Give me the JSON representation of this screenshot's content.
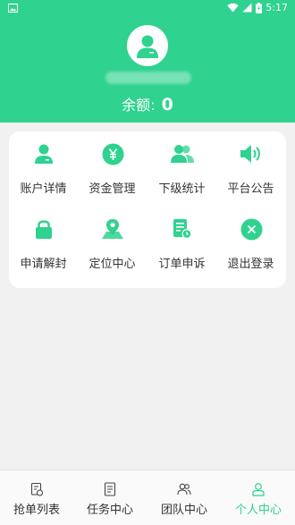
{
  "status_bar": {
    "time": "5:17"
  },
  "profile": {
    "balance_label": "余额:",
    "balance_value": "0"
  },
  "menu": [
    {
      "label": "账户详情",
      "icon": "user-icon"
    },
    {
      "label": "资金管理",
      "icon": "yen-icon"
    },
    {
      "label": "下级统计",
      "icon": "group-icon"
    },
    {
      "label": "平台公告",
      "icon": "speaker-icon"
    },
    {
      "label": "申请解封",
      "icon": "lock-icon"
    },
    {
      "label": "定位中心",
      "icon": "location-pin-icon"
    },
    {
      "label": "订单申诉",
      "icon": "document-clock-icon"
    },
    {
      "label": "退出登录",
      "icon": "close-circle-icon"
    }
  ],
  "tabs": [
    {
      "label": "抢单列表",
      "icon": "receipt-icon",
      "active": false
    },
    {
      "label": "任务中心",
      "icon": "clipboard-icon",
      "active": false
    },
    {
      "label": "团队中心",
      "icon": "team-icon",
      "active": false
    },
    {
      "label": "个人中心",
      "icon": "person-icon",
      "active": true
    }
  ],
  "colors": {
    "accent": "#2fd28f",
    "background": "#f1f1f1"
  }
}
